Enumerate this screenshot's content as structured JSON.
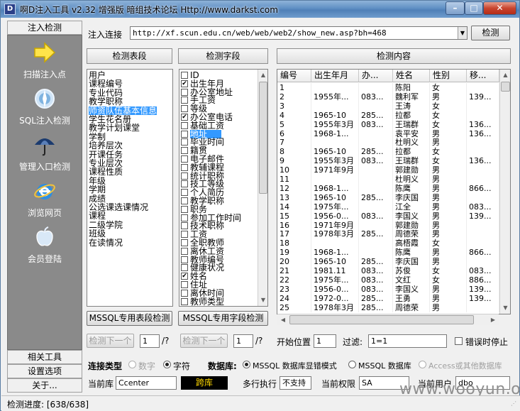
{
  "window": {
    "title": "啊D注入工具 v2.32 增强版 暗组技术论坛 Http://www.darkst.com",
    "icon_glyph": "D"
  },
  "sidebar": {
    "top_tab": "注入检测",
    "items": [
      {
        "label": "扫描注入点",
        "icon": "arrow-right-icon"
      },
      {
        "label": "SQL注入检测",
        "icon": "compass-icon"
      },
      {
        "label": "管理入口检测",
        "icon": "umbrella-icon"
      },
      {
        "label": "浏览网页",
        "icon": "ie-browser-icon"
      },
      {
        "label": "会员登陆",
        "icon": "apple-icon"
      }
    ],
    "bottom_tabs": [
      "相关工具",
      "设置选项",
      "关于..."
    ]
  },
  "toolbar": {
    "inject_label": "注入连接",
    "url": "http://xf.scun.edu.cn/web/web/web2/show_new.asp?bh=468",
    "detect_button": "检测"
  },
  "headers": {
    "tables": "检测表段",
    "fields": "检测字段",
    "content": "检测内容"
  },
  "tables_list": [
    "用户",
    "课程编号",
    "专业代码",
    "教学职称",
    "师资队伍基本信息",
    "学生花名册",
    "教学计划课堂",
    "学制",
    "培养层次",
    "开课任务",
    "专业层次",
    "课程性质",
    "年级",
    "学期",
    "成绩",
    "公选课选课情况",
    "课程",
    "二级学院",
    "班级",
    "在读情况"
  ],
  "tables_selected_index": 4,
  "fields_list": [
    {
      "label": "ID",
      "checked": false
    },
    {
      "label": "出生年月",
      "checked": true
    },
    {
      "label": "办公室地址",
      "checked": false
    },
    {
      "label": "手工资",
      "checked": false
    },
    {
      "label": "等级",
      "checked": false
    },
    {
      "label": "办公室电话",
      "checked": true
    },
    {
      "label": "基础工资",
      "checked": false
    },
    {
      "label": "地址",
      "checked": false
    },
    {
      "label": "毕业时间",
      "checked": false
    },
    {
      "label": "籍贯",
      "checked": false
    },
    {
      "label": "电子邮件",
      "checked": false
    },
    {
      "label": "教辅课程",
      "checked": false
    },
    {
      "label": "统计职称",
      "checked": false
    },
    {
      "label": "技工等级",
      "checked": false
    },
    {
      "label": "个人简历",
      "checked": false
    },
    {
      "label": "教学职称",
      "checked": false
    },
    {
      "label": "职务",
      "checked": false
    },
    {
      "label": "参加工作时间",
      "checked": false
    },
    {
      "label": "技术职称",
      "checked": false
    },
    {
      "label": "工资",
      "checked": false
    },
    {
      "label": "全职教师",
      "checked": false
    },
    {
      "label": "离休工资",
      "checked": false
    },
    {
      "label": "教师编号",
      "checked": false
    },
    {
      "label": "健康状况",
      "checked": false
    },
    {
      "label": "姓名",
      "checked": true
    },
    {
      "label": "住址",
      "checked": false
    },
    {
      "label": "离休时间",
      "checked": false
    },
    {
      "label": "教师类型",
      "checked": false
    }
  ],
  "fields_selected_index": 7,
  "grid": {
    "columns": [
      "编号",
      "出生年月",
      "办...",
      "姓名",
      "性别",
      "移..."
    ],
    "rows": [
      [
        "1",
        "",
        "",
        "陈阳",
        "女",
        ""
      ],
      [
        "2",
        "1955年...",
        "083...",
        "魏利军",
        "男",
        "139..."
      ],
      [
        "3",
        "",
        "",
        "王涛",
        "女",
        ""
      ],
      [
        "4",
        "1965-10",
        "285...",
        "拉都",
        "女",
        ""
      ],
      [
        "5",
        "1955年3月",
        "083...",
        "王瑞群",
        "女",
        "136..."
      ],
      [
        "6",
        "1968-1...",
        "",
        "袁平安",
        "男",
        "136..."
      ],
      [
        "7",
        "",
        "",
        "杜明义",
        "男",
        ""
      ],
      [
        "8",
        "1965-10",
        "285...",
        "拉都",
        "女",
        ""
      ],
      [
        "9",
        "1955年3月",
        "083...",
        "王瑞群",
        "女",
        "136..."
      ],
      [
        "10",
        "1971年9月",
        "",
        "郭建勋",
        "男",
        ""
      ],
      [
        "11",
        "",
        "",
        "杜明义",
        "男",
        ""
      ],
      [
        "12",
        "1968-1...",
        "",
        "陈鹰",
        "男",
        "866..."
      ],
      [
        "13",
        "1965-10",
        "285...",
        "李庆国",
        "男",
        ""
      ],
      [
        "14",
        "1975年...",
        "",
        "江全",
        "男",
        "083..."
      ],
      [
        "15",
        "1956-0...",
        "083...",
        "李国义",
        "男",
        "139..."
      ],
      [
        "16",
        "1971年9月",
        "",
        "郭建勋",
        "男",
        ""
      ],
      [
        "17",
        "1978年3月",
        "285...",
        "周德荣",
        "男",
        ""
      ],
      [
        "18",
        "",
        "",
        "高梧霞",
        "女",
        ""
      ],
      [
        "19",
        "1968-1...",
        "",
        "陈鹰",
        "男",
        "866..."
      ],
      [
        "20",
        "1965-10",
        "285...",
        "李庆国",
        "男",
        ""
      ],
      [
        "21",
        "1981.11",
        "083...",
        "苏俊",
        "女",
        "083..."
      ],
      [
        "22",
        "1975年...",
        "083...",
        "文红",
        "女",
        "886..."
      ],
      [
        "23",
        "1956-0...",
        "083...",
        "李国义",
        "男",
        "139..."
      ],
      [
        "24",
        "1972-0...",
        "285...",
        "王勇",
        "男",
        "139..."
      ],
      [
        "25",
        "1978年3月",
        "285...",
        "周德荣",
        "男",
        ""
      ]
    ]
  },
  "bottom_buttons": {
    "mssql_tables": "MSSQL专用表段检测",
    "mssql_fields": "MSSQL专用字段检测"
  },
  "pager": {
    "next_tables": "检测下一个",
    "tables_page": "1",
    "tables_suffix": "/?",
    "next_fields": "检测下一个",
    "fields_page": "1",
    "fields_suffix": "/?",
    "start_label": "开始位置",
    "start_value": "1",
    "filter_label": "过滤:",
    "filter_value": "1=1",
    "stop_on_error": "错误时停止"
  },
  "conn": {
    "type_label": "连接类型",
    "opt_number": "数字",
    "opt_string": "字符",
    "db_label": "数据库:",
    "db_opt_mssql_err": "MSSQL 数据库显错模式",
    "db_opt_mssql": "MSSQL 数据库",
    "db_opt_access": "Access或其他数据库",
    "current_db_label": "当前库",
    "current_db": "Ccenter",
    "cross_lib": "跨库",
    "multi_exec_label": "多行执行",
    "multi_exec": "不支持",
    "perm_label": "当前权限",
    "perm": "SA",
    "user_label": "当前用户",
    "user": "dbo"
  },
  "status": {
    "progress_text": "检测进度: [638/638]"
  },
  "watermark": "www.wooyun.org"
}
